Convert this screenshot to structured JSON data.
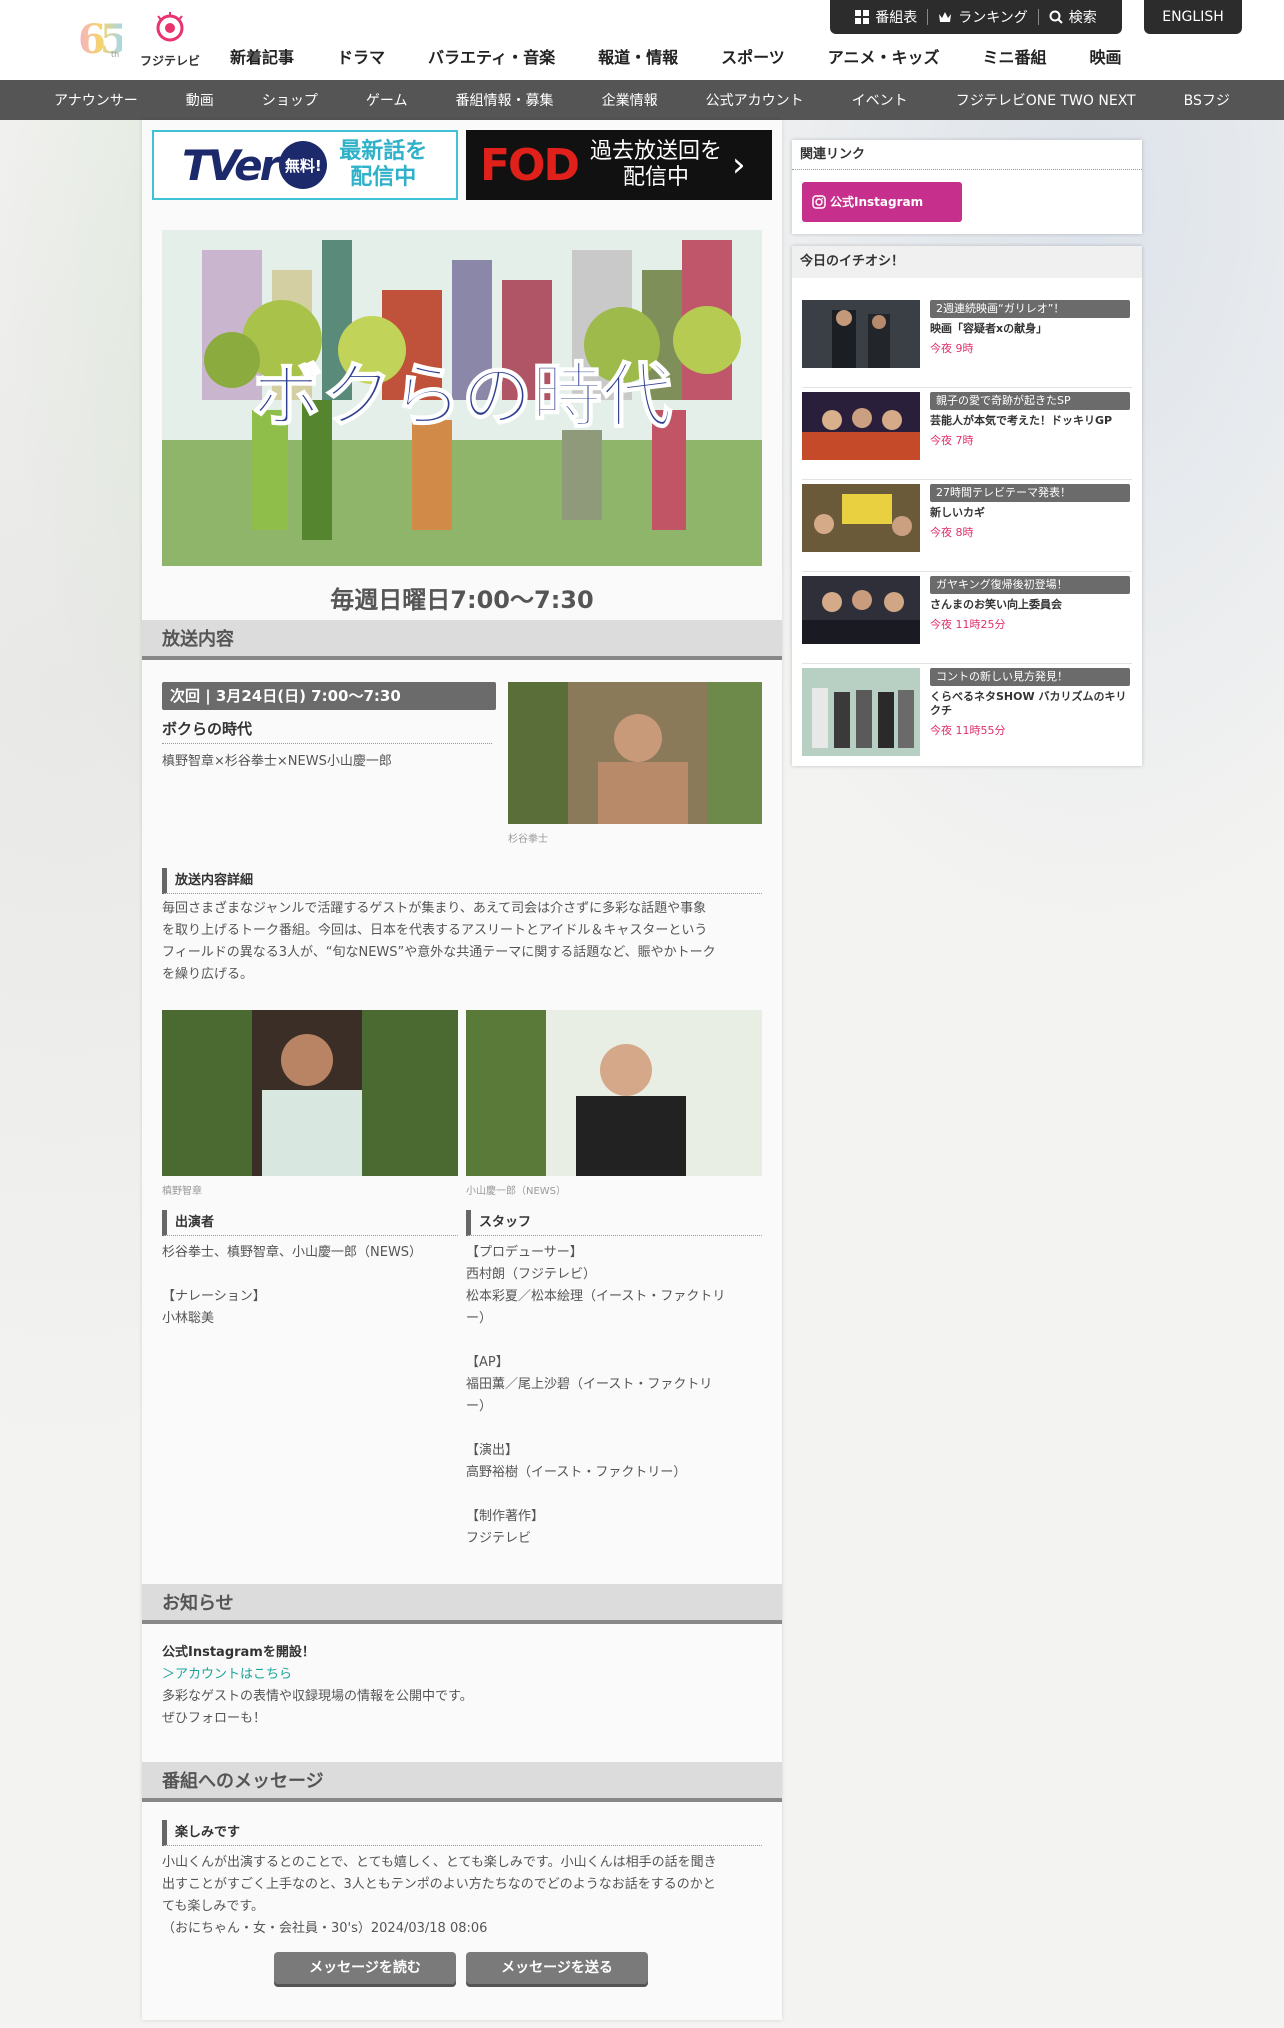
{
  "header": {
    "logo_number": "65",
    "logo_th": "th",
    "logo_name": "フジテレビ",
    "util": {
      "program_table": "番組表",
      "ranking": "ランキング",
      "search": "検索"
    },
    "english": "ENGLISH",
    "main_nav": [
      "新着記事",
      "ドラマ",
      "バラエティ・音楽",
      "報道・情報",
      "スポーツ",
      "アニメ・キッズ",
      "ミニ番組",
      "映画"
    ],
    "sub_nav": [
      "アナウンサー",
      "動画",
      "ショップ",
      "ゲーム",
      "番組情報・募集",
      "企業情報",
      "公式アカウント",
      "イベント",
      "フジテレビONE TWO NEXT",
      "BSフジ"
    ]
  },
  "banners": {
    "tver": {
      "logo": "TVer",
      "free": "無料!",
      "line1": "最新話を",
      "line2": "配信中"
    },
    "fod": {
      "logo": "FOD",
      "line1": "過去放送回を",
      "line2": "配信中",
      "arrow": "›"
    }
  },
  "hero": {
    "title": "ボクらの時代"
  },
  "schedule": "毎週日曜日7:00〜7:30",
  "broadcast": {
    "heading": "放送内容",
    "next_label": "次回 | 3月24日(日) 7:00〜7:30",
    "program_title": "ボクらの時代",
    "guests_line": "槙野智章×杉谷拳士×NEWS小山慶一郎",
    "photo1_caption": "杉谷拳士",
    "detail_heading": "放送内容詳細",
    "detail_text": [
      "毎回さまざまなジャンルで活躍するゲストが集まり、あえて司会は介さずに多彩な話題や事象",
      "を取り上げるトーク番組。今回は、日本を代表するアスリートとアイドル＆キャスターという",
      "フィールドの異なる3人が、“旬なNEWS”や意外な共通テーマに関する話題など、賑やかトーク",
      "を繰り広げる。"
    ],
    "photo2_caption": "槙野智章",
    "photo3_caption": "小山慶一郎（NEWS）",
    "cast_heading": "出演者",
    "cast_lines": [
      "杉谷拳士、槙野智章、小山慶一郎（NEWS）",
      "",
      "【ナレーション】",
      "小林聡美"
    ],
    "staff_heading": "スタッフ",
    "staff_lines": [
      "【プロデューサー】",
      "西村朗（フジテレビ）",
      "松本彩夏／松本絵理（イースト・ファクトリ",
      "ー）",
      "",
      "【AP】",
      "福田薫／尾上沙碧（イースト・ファクトリ",
      "ー）",
      "",
      "【演出】",
      "高野裕樹（イースト・ファクトリー）",
      "",
      "【制作著作】",
      "フジテレビ"
    ]
  },
  "news": {
    "heading": "お知らせ",
    "title": "公式Instagramを開設！",
    "link": "＞アカウントはこちら",
    "line1": "多彩なゲストの表情や収録現場の情報を公開中です。",
    "line2": "ぜひフォローも！"
  },
  "message": {
    "heading": "番組へのメッセージ",
    "title": "楽しみです",
    "body": [
      "小山くんが出演するとのことで、とても嬉しく、とても楽しみです。小山くんは相手の話を聞き",
      "出すことがすごく上手なのと、3人ともテンポのよい方たちなのでどのようなお話をするのかと",
      "ても楽しみです。"
    ],
    "signature": "（おにちゃん・女・会社員・30's）2024/03/18 08:06",
    "read_button": "メッセージを読む",
    "send_button": "メッセージを送る"
  },
  "sidebar": {
    "related_heading": "関連リンク",
    "instagram_button": "公式Instagram",
    "picks_heading": "今日のイチオシ！",
    "picks": [
      {
        "tag": "2週連続映画“ガリレオ”！",
        "title": "映画「容疑者xの献身」",
        "time": "今夜 9時"
      },
      {
        "tag": "親子の愛で奇跡が起きたSP",
        "title": "芸能人が本気で考えた！ドッキリGP",
        "time": "今夜 7時"
      },
      {
        "tag": "27時間テレビテーマ発表！",
        "title": "新しいカギ",
        "time": "今夜 8時"
      },
      {
        "tag": "ガヤキング復帰後初登場！",
        "title": "さんまのお笑い向上委員会",
        "time": "今夜 11時25分"
      },
      {
        "tag": "コントの新しい見方発見！",
        "title": "くらべるネタSHOW バカリズムのキリクチ",
        "time": "今夜 11時55分"
      }
    ]
  },
  "colors": {
    "accent_gray": "#6b6b6b",
    "instagram": "#c6308c",
    "time_red": "#e0306a",
    "link_teal": "#1aa59a",
    "fod_red": "#e0201b",
    "tver_blue": "#1c2a6b"
  },
  "icons": [
    "grid-icon",
    "crown-icon",
    "search-icon",
    "instagram-icon",
    "chevron-right-icon"
  ]
}
